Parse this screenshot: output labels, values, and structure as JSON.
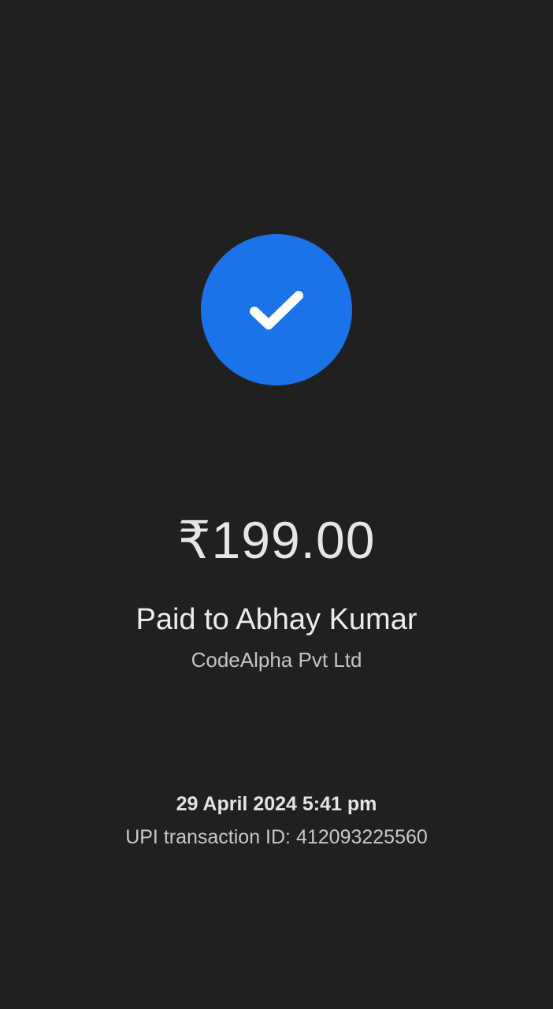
{
  "payment": {
    "status_icon": "check-icon",
    "accent_color": "#1a73e8",
    "amount": "₹199.00",
    "paid_to": "Paid to Abhay Kumar",
    "merchant": "CodeAlpha Pvt Ltd",
    "datetime": "29 April 2024 5:41 pm",
    "transaction_id": "UPI transaction ID: 412093225560"
  }
}
